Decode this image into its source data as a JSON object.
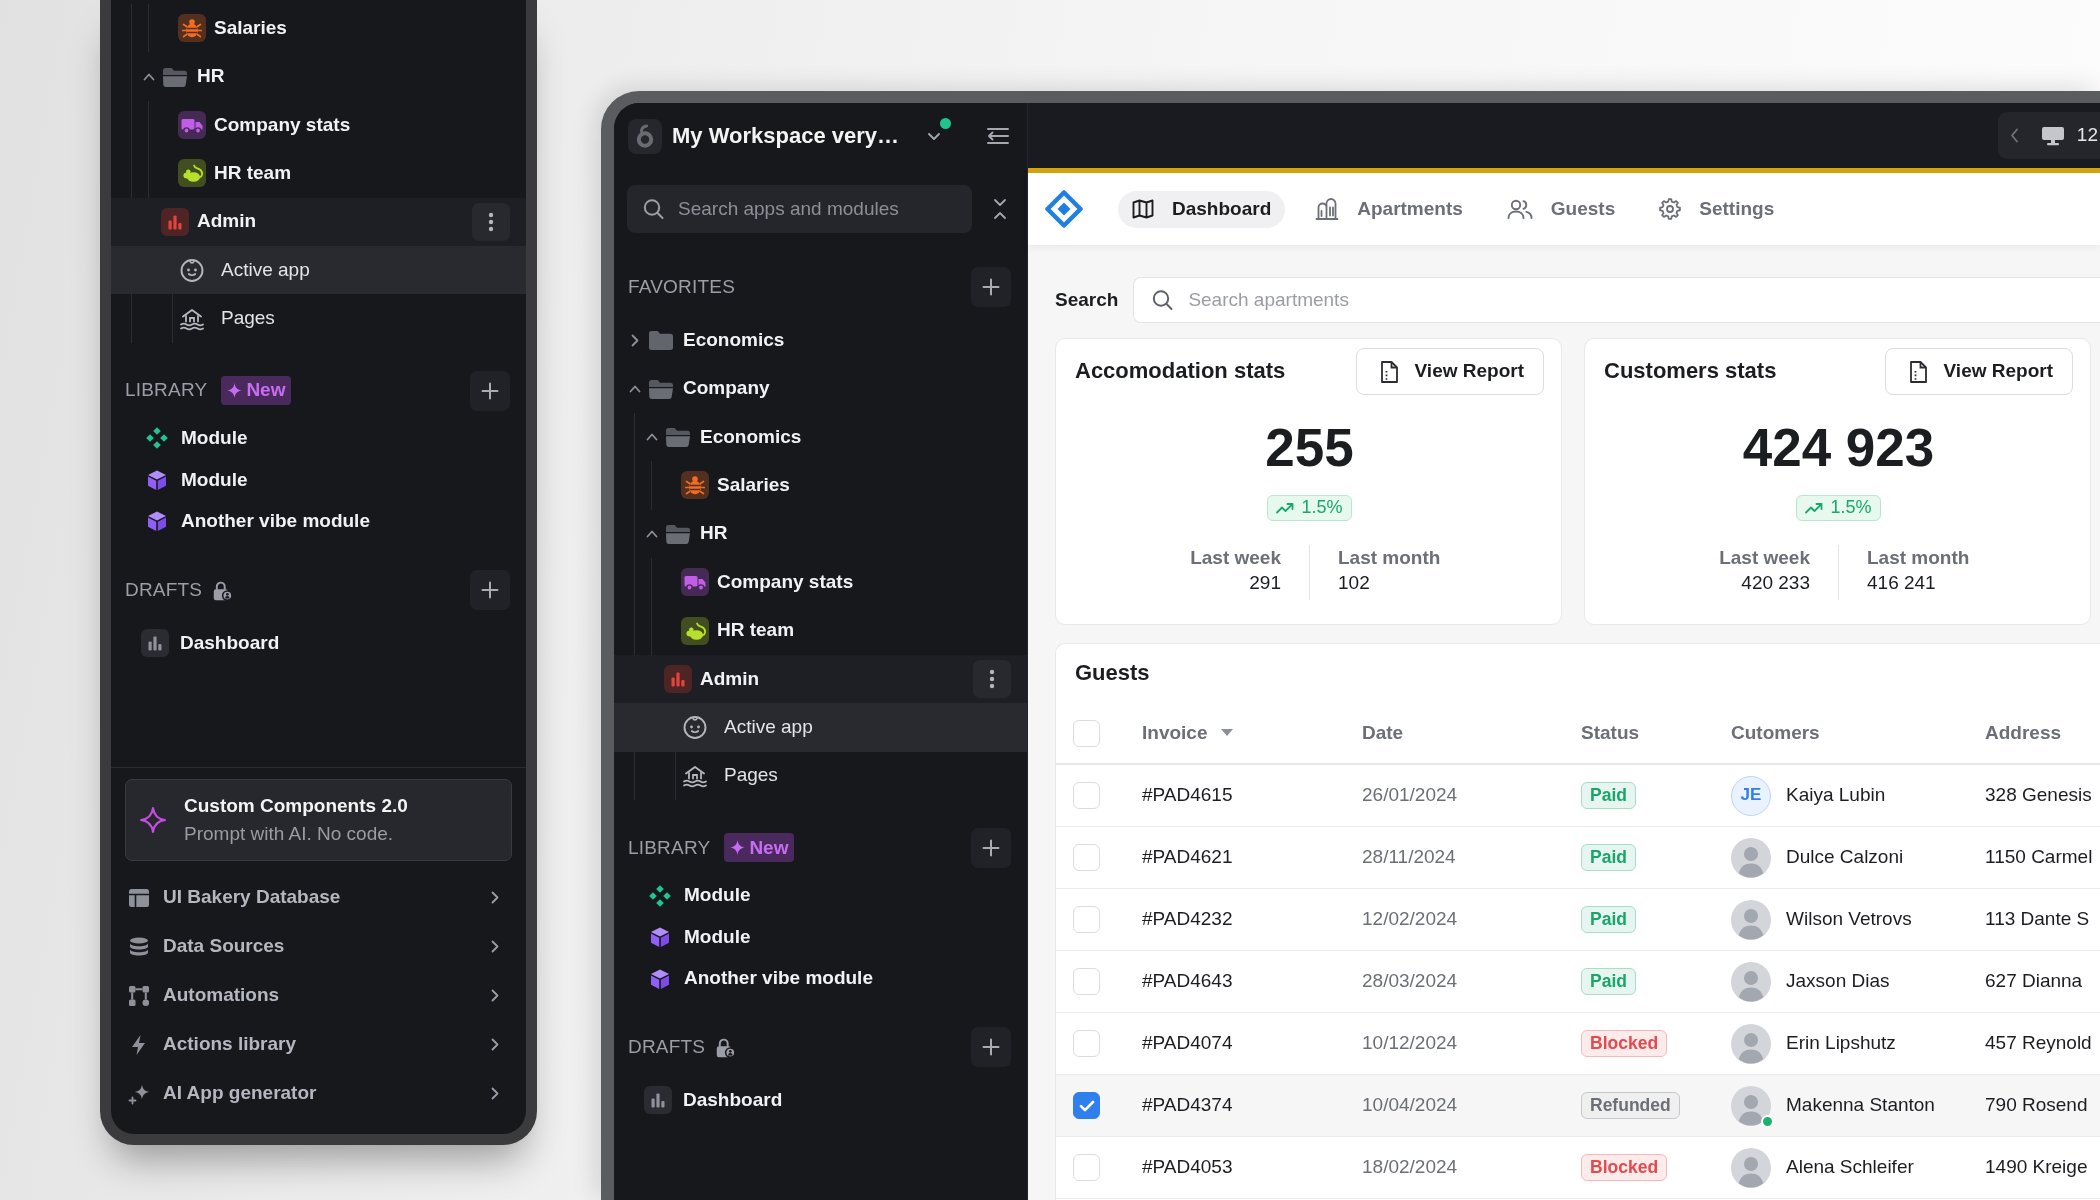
{
  "left_panel": {
    "tree": [
      {
        "children": [
          {
            "children": [
              {
                "kind": "app",
                "label": "Salaries",
                "color": "#522f1e",
                "selected": false,
                "hovered": false
              }
            ]
          },
          {
            "kind": "folder",
            "label": "HR",
            "expanded": true,
            "selected": false,
            "hovered": false,
            "children": [
              {
                "kind": "app",
                "label": "Company stats",
                "color": "#452b53",
                "selected": false,
                "hovered": false
              },
              {
                "kind": "app",
                "label": "HR team",
                "color": "#424e20",
                "selected": false,
                "hovered": false
              }
            ]
          },
          {
            "kind": "app",
            "label": "Admin",
            "color": "#4e2425",
            "selected": false,
            "hovered": true,
            "children": [
              {
                "kind": "page",
                "label": "Active app",
                "selected": true,
                "hovered": false
              },
              {
                "kind": "page",
                "label": "Pages",
                "selected": false,
                "hovered": false
              }
            ]
          }
        ]
      }
    ],
    "library": {
      "title": "LIBRARY",
      "badge": "New",
      "items": [
        {
          "kind": "component",
          "label": "Module"
        },
        {
          "kind": "module",
          "label": "Module"
        },
        {
          "kind": "module",
          "label": "Another vibe module"
        }
      ]
    },
    "drafts": {
      "title": "DRAFTS",
      "items": [
        {
          "label": "Dashboard"
        }
      ]
    },
    "promo": {
      "title": "Custom Components 2.0",
      "subtitle": "Prompt with AI. No code."
    },
    "menu": [
      {
        "label": "UI Bakery Database"
      },
      {
        "label": "Data Sources"
      },
      {
        "label": "Automations"
      },
      {
        "label": "Actions library"
      },
      {
        "label": "AI App generator"
      }
    ]
  },
  "sidebar": {
    "workspace": {
      "name": "My Workspace very…",
      "online": true
    },
    "search": {
      "placeholder": "Search apps and modules"
    },
    "favorites": {
      "title": "FAVORITES"
    },
    "tree": [
      {
        "kind": "folder",
        "label": "Economics",
        "expanded": false,
        "selected": false,
        "hovered": false
      },
      {
        "kind": "folder",
        "label": "Company",
        "expanded": true,
        "selected": false,
        "hovered": false,
        "children": [
          {
            "kind": "folder",
            "label": "Economics",
            "expanded": true,
            "selected": false,
            "hovered": false,
            "children": [
              {
                "kind": "app",
                "label": "Salaries",
                "color": "#522f1e",
                "selected": false,
                "hovered": false
              }
            ]
          },
          {
            "kind": "folder",
            "label": "HR",
            "expanded": true,
            "selected": false,
            "hovered": false,
            "children": [
              {
                "kind": "app",
                "label": "Company stats",
                "color": "#452b53",
                "selected": false,
                "hovered": false
              },
              {
                "kind": "app",
                "label": "HR team",
                "color": "#424e20",
                "selected": false,
                "hovered": false
              }
            ]
          },
          {
            "kind": "app",
            "label": "Admin",
            "color": "#4e2425",
            "selected": false,
            "hovered": true,
            "children": [
              {
                "kind": "page",
                "label": "Active app",
                "selected": true,
                "hovered": false
              },
              {
                "kind": "page",
                "label": "Pages",
                "selected": false,
                "hovered": false
              }
            ]
          }
        ]
      }
    ],
    "library": {
      "title": "LIBRARY",
      "badge": "New",
      "items": [
        {
          "kind": "component",
          "label": "Module"
        },
        {
          "kind": "module",
          "label": "Module"
        },
        {
          "kind": "module",
          "label": "Another vibe module"
        }
      ]
    },
    "drafts": {
      "title": "DRAFTS",
      "items": [
        {
          "label": "Dashboard"
        }
      ]
    }
  },
  "topbar": {
    "text": "12"
  },
  "nav": {
    "tabs": [
      {
        "label": "Dashboard",
        "selected": true
      },
      {
        "label": "Apartments",
        "selected": false
      },
      {
        "label": "Guests",
        "selected": false
      },
      {
        "label": "Settings",
        "selected": false
      }
    ]
  },
  "search": {
    "label": "Search",
    "placeholder": "Search apartments"
  },
  "stats": [
    {
      "title": "Accomodation stats",
      "button": "View Report",
      "value": "255",
      "change": "1.5%",
      "last_week": {
        "label": "Last week",
        "value": "291"
      },
      "last_month": {
        "label": "Last month",
        "value": "102"
      }
    },
    {
      "title": "Customers stats",
      "button": "View Report",
      "value": "424 923",
      "change": "1.5%",
      "last_week": {
        "label": "Last week",
        "value": "420 233"
      },
      "last_month": {
        "label": "Last month",
        "value": "416 241"
      }
    }
  ],
  "guests": {
    "title": "Guests",
    "all_checked": false,
    "columns": [
      {
        "label": "Invoice",
        "sorted": true
      },
      {
        "label": "Date",
        "sorted": false
      },
      {
        "label": "Status",
        "sorted": false
      },
      {
        "label": "Cutomers",
        "sorted": false
      },
      {
        "label": "Address",
        "sorted": false
      }
    ],
    "rows": [
      {
        "selected": false,
        "invoice": "#PAD4615",
        "date": "26/01/2024",
        "status": {
          "text": "Paid",
          "color": "#1aa56a"
        },
        "customer": "Kaiya Lubin",
        "avatar": {
          "kind": "initials",
          "text": "JE"
        },
        "online": false,
        "address": "328 Genesis"
      },
      {
        "selected": false,
        "invoice": "#PAD4621",
        "date": "28/11/2024",
        "status": {
          "text": "Paid",
          "color": "#1aa56a"
        },
        "customer": "Dulce Calzoni",
        "avatar": {
          "kind": "photo"
        },
        "online": false,
        "address": "1150 Carmel"
      },
      {
        "selected": false,
        "invoice": "#PAD4232",
        "date": "12/02/2024",
        "status": {
          "text": "Paid",
          "color": "#1aa56a"
        },
        "customer": "Wilson Vetrovs",
        "avatar": {
          "kind": "photo"
        },
        "online": false,
        "address": "113 Dante S"
      },
      {
        "selected": false,
        "invoice": "#PAD4643",
        "date": "28/03/2024",
        "status": {
          "text": "Paid",
          "color": "#1aa56a"
        },
        "customer": "Jaxson Dias",
        "avatar": {
          "kind": "photo"
        },
        "online": false,
        "address": "627 Dianna"
      },
      {
        "selected": false,
        "invoice": "#PAD4074",
        "date": "10/12/2024",
        "status": {
          "text": "Blocked",
          "color": "#e5484d"
        },
        "customer": "Erin Lipshutz",
        "avatar": {
          "kind": "photo"
        },
        "online": false,
        "address": "457 Reynold"
      },
      {
        "selected": true,
        "invoice": "#PAD4374",
        "date": "10/04/2024",
        "status": {
          "text": "Refunded",
          "color": "#6c6f77"
        },
        "customer": "Makenna Stanton",
        "avatar": {
          "kind": "photo"
        },
        "online": true,
        "address": "790 Rosend"
      },
      {
        "selected": false,
        "invoice": "#PAD4053",
        "date": "18/02/2024",
        "status": {
          "text": "Blocked",
          "color": "#e5484d"
        },
        "customer": "Alena Schleifer",
        "avatar": {
          "kind": "photo"
        },
        "online": false,
        "address": "1490 Kreige"
      }
    ]
  }
}
